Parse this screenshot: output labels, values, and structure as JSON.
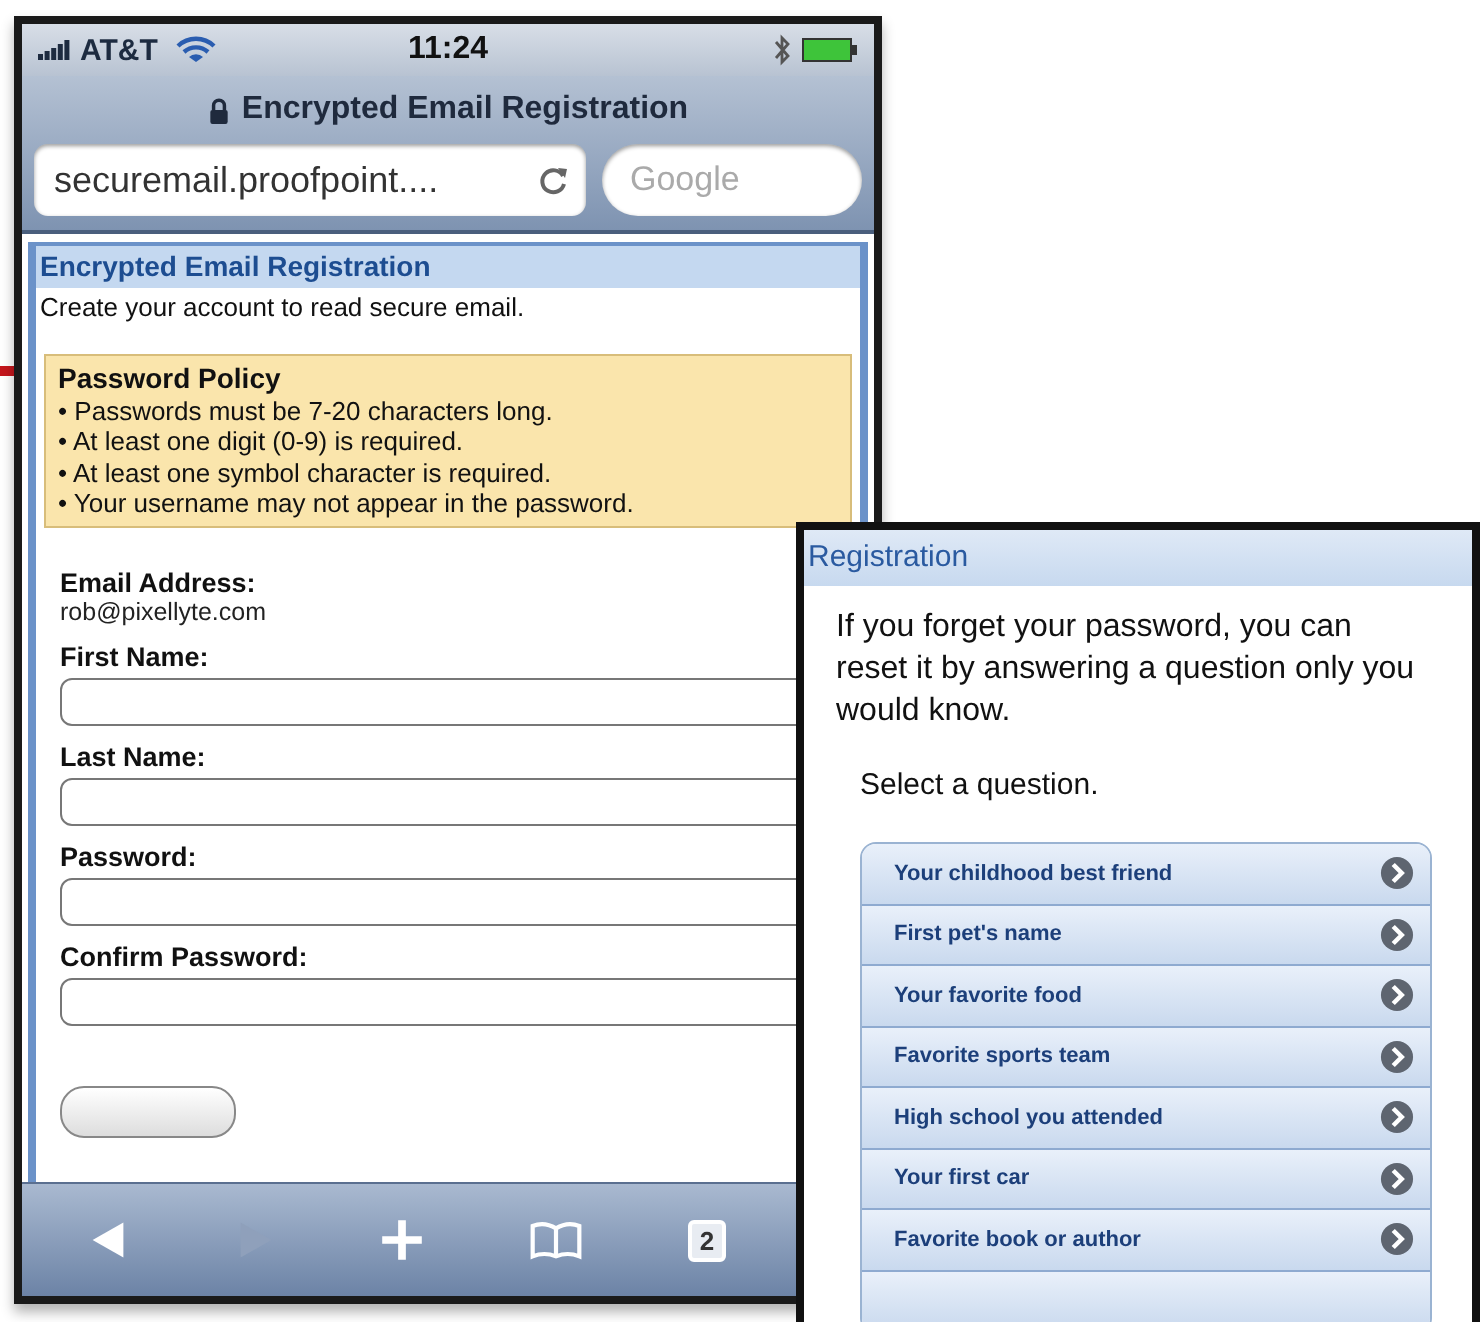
{
  "status_bar": {
    "carrier": "AT&T",
    "time": "11:24"
  },
  "browser": {
    "page_title": "Encrypted Email Registration",
    "url": "securemail.proofpoint....",
    "search_placeholder": "Google",
    "tab_count": "2",
    "nav_buttons": [
      {
        "kind": "back",
        "disabled": false
      },
      {
        "kind": "forward",
        "disabled": true
      }
    ]
  },
  "form": {
    "heading": "Encrypted Email Registration",
    "intro": "Create your account to read secure email.",
    "policy": {
      "title": "Password Policy",
      "rules": [
        "• Passwords must be 7-20 characters long.",
        "• At least one digit (0-9) is required.",
        "• At least one symbol character is required.",
        "• Your username may not appear in the password."
      ]
    },
    "email_label": "Email Address:",
    "email": "rob@pixellyte.com",
    "fields": [
      {
        "label": "First Name:"
      },
      {
        "label": "Last Name:"
      },
      {
        "label": "Password:"
      },
      {
        "label": "Confirm Password:"
      }
    ]
  },
  "reset": {
    "heading": "Registration",
    "intro": "If you forget your password, you can reset it by answering a question only you would know.",
    "prompt": "Select a question.",
    "questions": [
      "Your childhood best friend",
      "First pet's name",
      "Your favorite food",
      "Favorite sports team",
      "High school you attended",
      "Your first car",
      "Favorite book or author"
    ]
  }
}
